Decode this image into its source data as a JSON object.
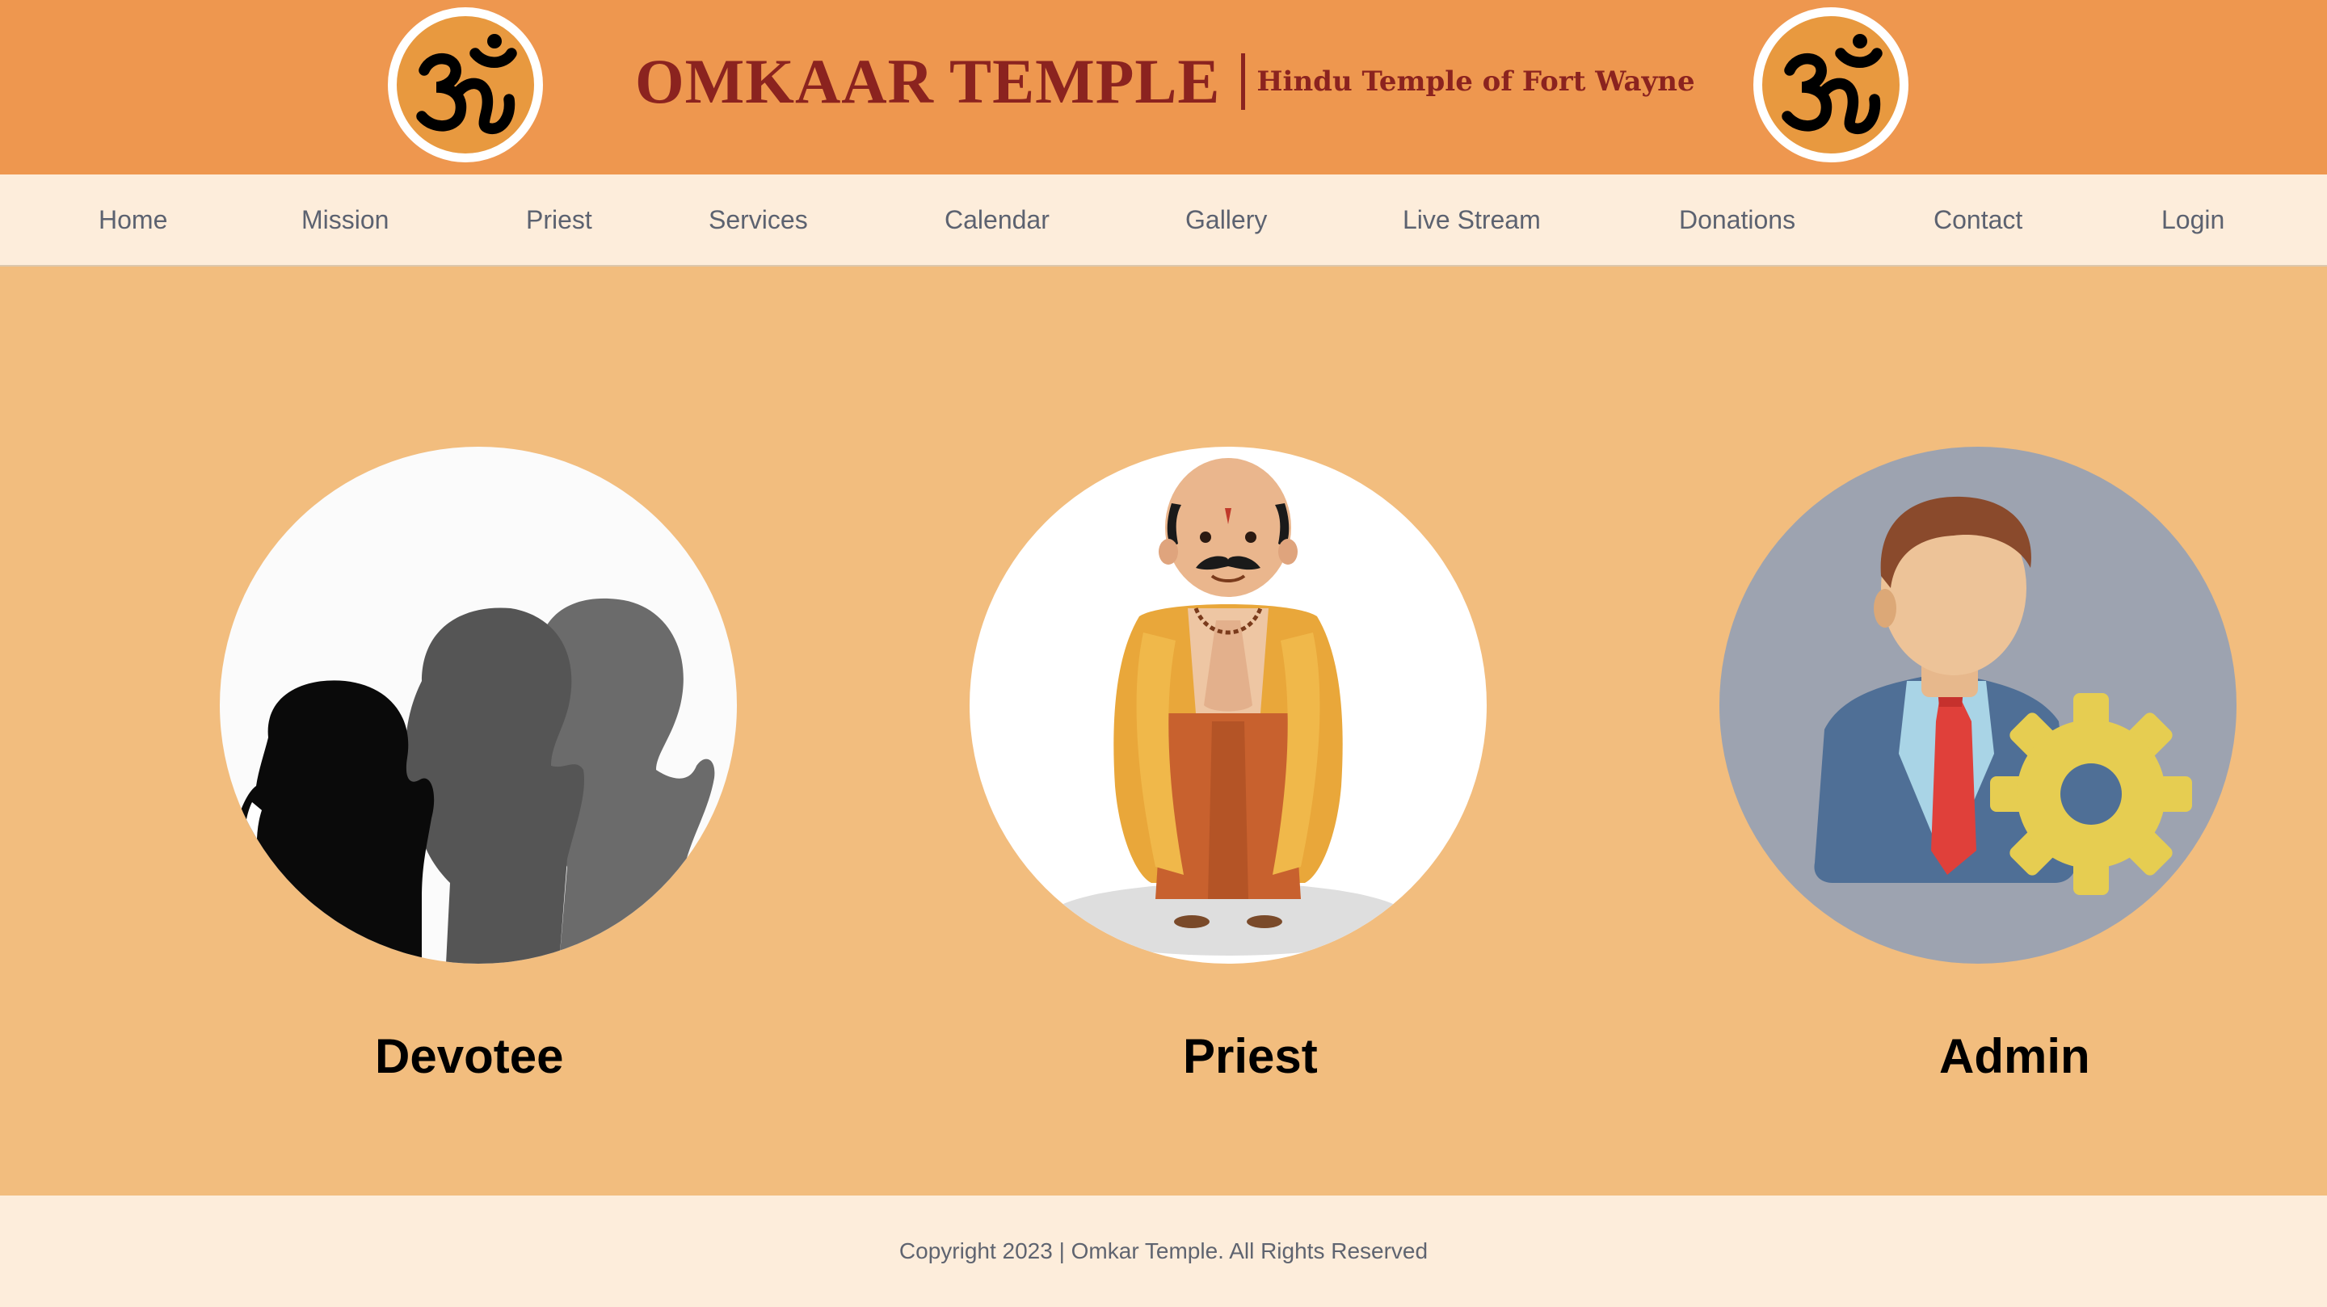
{
  "header": {
    "title": "OMKAAR TEMPLE",
    "subtitle": "Hindu Temple of Fort Wayne",
    "logo_icon": "om-symbol-icon"
  },
  "nav": {
    "items": [
      {
        "label": "Home"
      },
      {
        "label": "Mission"
      },
      {
        "label": "Priest"
      },
      {
        "label": "Services"
      },
      {
        "label": "Calendar"
      },
      {
        "label": "Gallery"
      },
      {
        "label": "Live Stream"
      },
      {
        "label": "Donations"
      },
      {
        "label": "Contact"
      },
      {
        "label": "Login"
      }
    ]
  },
  "roles": [
    {
      "label": "Devotee",
      "image": "praying-devotees-silhouette"
    },
    {
      "label": "Priest",
      "image": "priest-cartoon-illustration"
    },
    {
      "label": "Admin",
      "image": "admin-user-gear-icon"
    }
  ],
  "footer": {
    "copyright": "Copyright 2023 | Omkar Temple. All Rights Reserved"
  },
  "colors": {
    "header_bg": "#ee974f",
    "nav_bg": "#fdeddb",
    "main_bg": "#f2bd7e",
    "title": "#8b231f",
    "nav_text": "#5c6270"
  }
}
